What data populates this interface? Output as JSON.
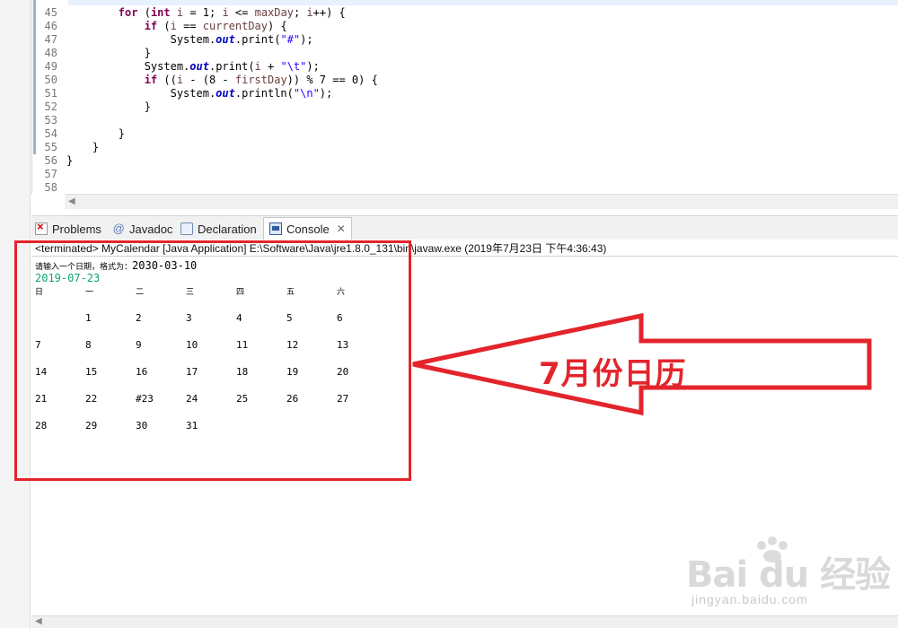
{
  "editor": {
    "lines": [
      {
        "n": "45",
        "parts": [
          {
            "t": "        ",
            "c": "pl"
          },
          {
            "t": "for",
            "c": "kw"
          },
          {
            "t": " (",
            "c": "pl"
          },
          {
            "t": "int",
            "c": "kw"
          },
          {
            "t": " ",
            "c": "pl"
          },
          {
            "t": "i",
            "c": "var"
          },
          {
            "t": " = 1; ",
            "c": "pl"
          },
          {
            "t": "i",
            "c": "var"
          },
          {
            "t": " <= ",
            "c": "pl"
          },
          {
            "t": "maxDay",
            "c": "var"
          },
          {
            "t": "; ",
            "c": "pl"
          },
          {
            "t": "i",
            "c": "var"
          },
          {
            "t": "++) {",
            "c": "pl"
          }
        ]
      },
      {
        "n": "46",
        "parts": [
          {
            "t": "            ",
            "c": "pl"
          },
          {
            "t": "if",
            "c": "kw"
          },
          {
            "t": " (",
            "c": "pl"
          },
          {
            "t": "i",
            "c": "var"
          },
          {
            "t": " == ",
            "c": "pl"
          },
          {
            "t": "currentDay",
            "c": "var"
          },
          {
            "t": ") {",
            "c": "pl"
          }
        ]
      },
      {
        "n": "47",
        "parts": [
          {
            "t": "                System.",
            "c": "pl"
          },
          {
            "t": "out",
            "c": "fld"
          },
          {
            "t": ".print(",
            "c": "pl"
          },
          {
            "t": "\"#\"",
            "c": "str"
          },
          {
            "t": ");",
            "c": "pl"
          }
        ]
      },
      {
        "n": "48",
        "parts": [
          {
            "t": "            }",
            "c": "pl"
          }
        ]
      },
      {
        "n": "49",
        "parts": [
          {
            "t": "            System.",
            "c": "pl"
          },
          {
            "t": "out",
            "c": "fld"
          },
          {
            "t": ".print(",
            "c": "pl"
          },
          {
            "t": "i",
            "c": "var"
          },
          {
            "t": " + ",
            "c": "pl"
          },
          {
            "t": "\"\\t\"",
            "c": "str"
          },
          {
            "t": ");",
            "c": "pl"
          }
        ]
      },
      {
        "n": "50",
        "parts": [
          {
            "t": "            ",
            "c": "pl"
          },
          {
            "t": "if",
            "c": "kw"
          },
          {
            "t": " ((",
            "c": "pl"
          },
          {
            "t": "i",
            "c": "var"
          },
          {
            "t": " - (8 - ",
            "c": "pl"
          },
          {
            "t": "firstDay",
            "c": "var"
          },
          {
            "t": ")) % 7 == 0) {",
            "c": "pl"
          }
        ]
      },
      {
        "n": "51",
        "parts": [
          {
            "t": "                System.",
            "c": "pl"
          },
          {
            "t": "out",
            "c": "fld"
          },
          {
            "t": ".println(",
            "c": "pl"
          },
          {
            "t": "\"\\n\"",
            "c": "str"
          },
          {
            "t": ");",
            "c": "pl"
          }
        ]
      },
      {
        "n": "52",
        "parts": [
          {
            "t": "            }",
            "c": "pl"
          }
        ]
      },
      {
        "n": "53",
        "parts": [
          {
            "t": "",
            "c": "pl"
          }
        ]
      },
      {
        "n": "54",
        "parts": [
          {
            "t": "        }",
            "c": "pl"
          }
        ]
      },
      {
        "n": "55",
        "parts": [
          {
            "t": "    }",
            "c": "pl"
          }
        ]
      },
      {
        "n": "56",
        "parts": [
          {
            "t": "}",
            "c": "pl"
          }
        ]
      },
      {
        "n": "57",
        "parts": [
          {
            "t": "",
            "c": "pl"
          }
        ]
      },
      {
        "n": "58",
        "parts": [
          {
            "t": "",
            "c": "pl"
          }
        ]
      }
    ]
  },
  "tabs": {
    "problems": "Problems",
    "javadoc": "Javadoc",
    "declaration": "Declaration",
    "console": "Console"
  },
  "console": {
    "header": "<terminated> MyCalendar [Java Application] E:\\Software\\Java\\jre1.8.0_131\\bin\\javaw.exe (2019年7月23日 下午4:36:43)",
    "prompt": "请输入一个日期，格式为：",
    "prompt_value": "2030-03-10",
    "input_echo": "2019-07-23",
    "weekdays": [
      "日",
      "一",
      "二",
      "三",
      "四",
      "五",
      "六"
    ],
    "weeks": [
      [
        "",
        "1",
        "2",
        "3",
        "4",
        "5",
        "6"
      ],
      [
        "7",
        "8",
        "9",
        "10",
        "11",
        "12",
        "13"
      ],
      [
        "14",
        "15",
        "16",
        "17",
        "18",
        "19",
        "20"
      ],
      [
        "21",
        "22",
        "#23",
        "24",
        "25",
        "26",
        "27"
      ],
      [
        "28",
        "29",
        "30",
        "31",
        "",
        "",
        ""
      ]
    ]
  },
  "annotation": {
    "label": "7月份日历",
    "color": "#e3242b"
  },
  "watermark": {
    "brand": "Bai du 经验",
    "url": "jingyan.baidu.com"
  }
}
